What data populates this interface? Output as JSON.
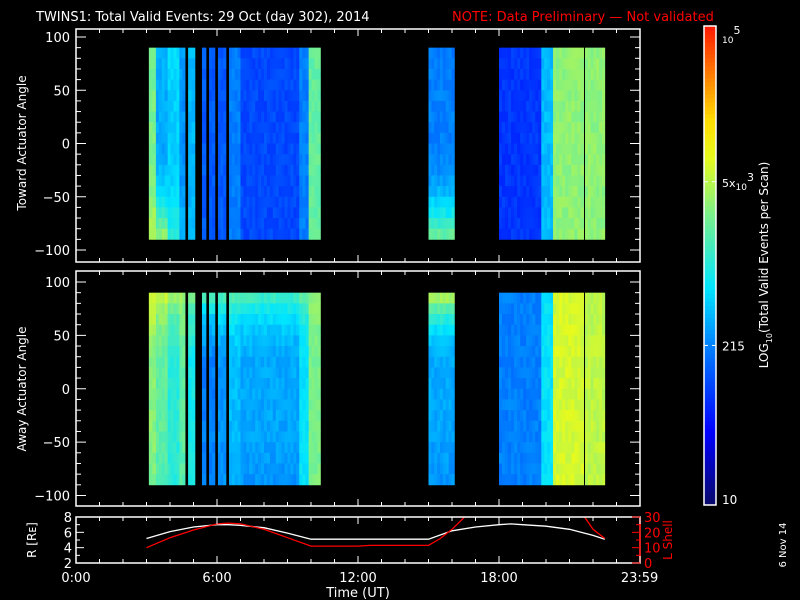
{
  "title": {
    "main": "TWINS1: Total Valid Events: 29 Oct (day 302), 2014",
    "note": "NOTE: Data Preliminary — Not validated",
    "note_color": "#ff0000"
  },
  "date_stamp": "6 Nov 14",
  "chart_data": [
    {
      "type": "heatmap",
      "name": "toward",
      "ylabel": "Toward Actuator Angle",
      "ylim": [
        -100,
        100
      ],
      "yticks": [
        -100,
        -50,
        0,
        50,
        100
      ],
      "ytick_labels": [
        "−100",
        "−50",
        "0",
        "50",
        "100"
      ],
      "xlim_hours": [
        0,
        24
      ],
      "angle_range": [
        -90,
        90
      ],
      "stripes_log10": [
        {
          "t0": 3.1,
          "t1": 3.4,
          "v": 3.4,
          "vt": 3.4,
          "vb": 3.7
        },
        {
          "t0": 3.4,
          "t1": 3.9,
          "v": 2.5,
          "vt": 2.6,
          "vb": 3.6
        },
        {
          "t0": 3.9,
          "t1": 4.4,
          "v": 2.7,
          "vt": 2.8,
          "vb": 3.0
        },
        {
          "t0": 4.4,
          "t1": 4.64,
          "v": 2.4,
          "vt": 2.5,
          "vb": 2.6
        },
        {
          "t0": 4.77,
          "t1": 5.06,
          "v": 2.6,
          "vt": 2.6,
          "vb": 2.6
        },
        {
          "t0": 5.36,
          "t1": 5.53,
          "v": 2.1,
          "vt": 2.1,
          "vb": 2.1
        },
        {
          "t0": 5.66,
          "t1": 5.91,
          "v": 2.1,
          "vt": 2.1,
          "vb": 2.1
        },
        {
          "t0": 6.04,
          "t1": 6.38,
          "v": 2.1,
          "vt": 2.1,
          "vb": 2.1
        },
        {
          "t0": 6.51,
          "t1": 7.0,
          "v": 2.3,
          "vt": 2.3,
          "vb": 2.3
        },
        {
          "t0": 7.0,
          "t1": 9.5,
          "v": 2.0,
          "vt": 2.0,
          "vb": 2.0
        },
        {
          "t0": 9.5,
          "t1": 9.9,
          "v": 2.3,
          "vt": 2.3,
          "vb": 2.3
        },
        {
          "t0": 9.9,
          "t1": 10.4,
          "v": 3.3,
          "vt": 3.3,
          "vb": 3.3
        },
        {
          "t0": 15.0,
          "t1": 16.1,
          "v": 2.3,
          "vt": 2.3,
          "vb": 3.4
        },
        {
          "t0": 18.0,
          "t1": 19.8,
          "v": 1.9,
          "vt": 1.9,
          "vb": 1.9
        },
        {
          "t0": 19.8,
          "t1": 20.3,
          "v": 2.6,
          "vt": 2.6,
          "vb": 2.6
        },
        {
          "t0": 20.3,
          "t1": 21.6,
          "v": 3.5,
          "vt": 3.5,
          "vb": 3.5
        },
        {
          "t0": 21.66,
          "t1": 22.5,
          "v": 3.5,
          "vt": 3.5,
          "vb": 3.5
        }
      ]
    },
    {
      "type": "heatmap",
      "name": "away",
      "ylabel": "Away Actuator Angle",
      "ylim": [
        -100,
        100
      ],
      "yticks": [
        -100,
        -50,
        0,
        50,
        100
      ],
      "ytick_labels": [
        "−100",
        "−50",
        "0",
        "50",
        "100"
      ],
      "xlim_hours": [
        0,
        24
      ],
      "angle_range": [
        -90,
        90
      ],
      "stripes_log10": [
        {
          "t0": 3.1,
          "t1": 3.4,
          "v": 3.5,
          "vt": 3.9,
          "vb": 3.4
        },
        {
          "t0": 3.4,
          "t1": 3.9,
          "v": 3.3,
          "vt": 3.8,
          "vb": 3.2
        },
        {
          "t0": 3.9,
          "t1": 4.4,
          "v": 3.0,
          "vt": 3.6,
          "vb": 3.0
        },
        {
          "t0": 4.4,
          "t1": 4.64,
          "v": 3.3,
          "vt": 3.6,
          "vb": 3.2
        },
        {
          "t0": 4.77,
          "t1": 5.06,
          "v": 2.9,
          "vt": 3.5,
          "vb": 2.9
        },
        {
          "t0": 5.36,
          "t1": 5.53,
          "v": 2.3,
          "vt": 3.3,
          "vb": 2.3
        },
        {
          "t0": 5.66,
          "t1": 5.91,
          "v": 2.3,
          "vt": 3.3,
          "vb": 2.3
        },
        {
          "t0": 6.04,
          "t1": 6.38,
          "v": 2.4,
          "vt": 3.3,
          "vb": 2.4
        },
        {
          "t0": 6.51,
          "t1": 7.0,
          "v": 2.6,
          "vt": 3.3,
          "vb": 2.5
        },
        {
          "t0": 7.0,
          "t1": 9.5,
          "v": 2.5,
          "vt": 3.2,
          "vb": 2.4
        },
        {
          "t0": 9.5,
          "t1": 9.9,
          "v": 2.8,
          "vt": 3.3,
          "vb": 2.8
        },
        {
          "t0": 9.9,
          "t1": 10.4,
          "v": 3.4,
          "vt": 3.5,
          "vb": 3.4
        },
        {
          "t0": 15.0,
          "t1": 16.1,
          "v": 2.5,
          "vt": 3.8,
          "vb": 2.4
        },
        {
          "t0": 18.0,
          "t1": 19.8,
          "v": 2.3,
          "vt": 2.3,
          "vb": 2.3
        },
        {
          "t0": 19.8,
          "t1": 20.3,
          "v": 2.8,
          "vt": 2.8,
          "vb": 2.8
        },
        {
          "t0": 20.3,
          "t1": 21.6,
          "v": 3.8,
          "vt": 3.8,
          "vb": 3.8
        },
        {
          "t0": 21.66,
          "t1": 22.5,
          "v": 3.7,
          "vt": 3.7,
          "vb": 3.7
        }
      ]
    },
    {
      "type": "line",
      "name": "orbit",
      "ylabel": "R [Rᴇ]",
      "ylim": [
        2,
        8
      ],
      "yticks": [
        2,
        4,
        6,
        8
      ],
      "ytick_labels": [
        "2",
        "4",
        "6",
        "8"
      ],
      "y2label": "L Shell",
      "y2lim": [
        0,
        30
      ],
      "y2ticks": [
        0,
        10,
        20,
        30
      ],
      "y2tick_labels": [
        "0",
        "10",
        "20",
        "30"
      ],
      "xlabel": "Time (UT)",
      "xticks_hours": [
        0,
        6,
        12,
        18,
        23.983
      ],
      "xtick_labels": [
        "0:00",
        "6:00",
        "12:00",
        "18:00",
        "23:59"
      ],
      "series": [
        {
          "name": "R",
          "color": "#ffffff",
          "x": [
            3.0,
            4.0,
            5.0,
            6.0,
            6.5,
            7.0,
            8.0,
            9.0,
            10.0,
            12.0,
            15.0,
            16.0,
            17.0,
            18.0,
            18.5,
            19.0,
            20.0,
            21.0,
            22.0,
            22.5
          ],
          "y": [
            5.2,
            6.1,
            6.7,
            7.0,
            7.0,
            6.9,
            6.6,
            5.9,
            5.1,
            5.1,
            5.1,
            6.2,
            6.7,
            7.0,
            7.1,
            7.0,
            6.8,
            6.4,
            5.6,
            5.1
          ]
        },
        {
          "name": "L Shell",
          "color": "#ff0000",
          "x": [
            3.0,
            4.0,
            5.0,
            6.0,
            6.5,
            7.0,
            8.0,
            9.0,
            10.0,
            12.0,
            12.5,
            15.0,
            15.5,
            16.0,
            16.6,
            null,
            21.6,
            22.0,
            22.5
          ],
          "y": [
            10.0,
            16.5,
            21.5,
            25.5,
            26.0,
            25.5,
            22.0,
            16.5,
            11.0,
            11.0,
            11.5,
            11.5,
            16.0,
            22.0,
            31.0,
            null,
            31.0,
            22.0,
            16.0
          ]
        }
      ]
    }
  ],
  "colorbar": {
    "label": "LOG10(Total Valid Events per Scan)",
    "label_prefix": "LOG",
    "label_sub": "10",
    "label_rest": "(Total Valid Events per Scan)",
    "range": [
      10,
      100000
    ],
    "tick_values": [
      10,
      215,
      5000,
      100000
    ],
    "ticks": [
      {
        "base": "10",
        "sup": "",
        "pre": ""
      },
      {
        "base": "215",
        "sup": "",
        "pre": ""
      },
      {
        "base": "10",
        "sup": "3",
        "pre": "5x"
      },
      {
        "base": "10",
        "sup": "5",
        "pre": ""
      }
    ]
  }
}
